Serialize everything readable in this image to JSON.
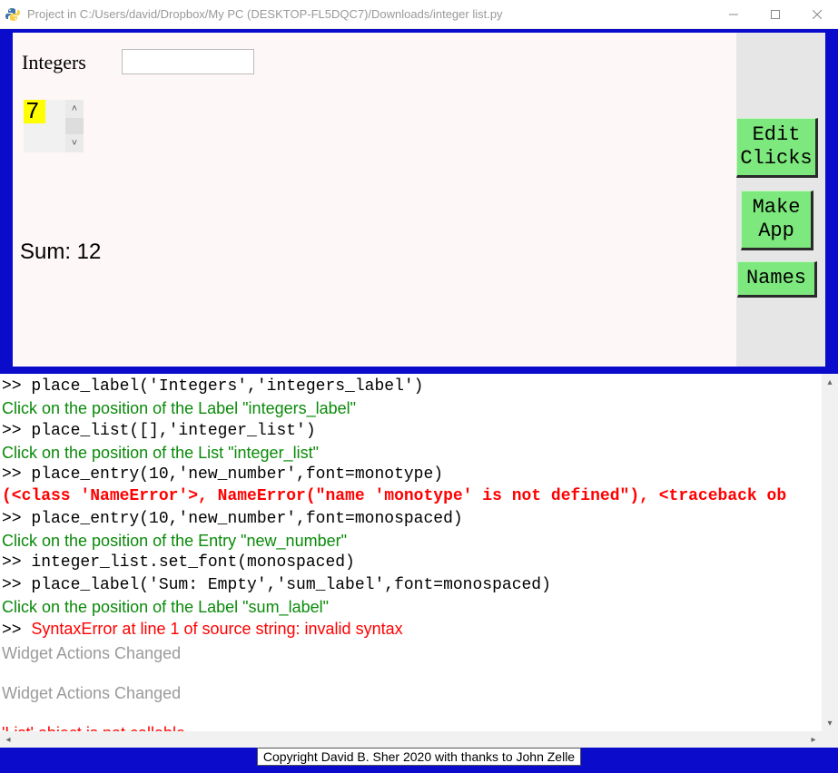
{
  "window": {
    "title": "Project in C:/Users/david/Dropbox/My PC (DESKTOP-FL5DQC7)/Downloads/integer list.py"
  },
  "panel": {
    "integers_label": "Integers",
    "entry_value": "",
    "list_selected": "7",
    "sum_label": "Sum: 12"
  },
  "buttons": {
    "edit_clicks": "Edit\nClicks",
    "make_app": "Make\nApp",
    "names": "Names"
  },
  "console_lines": [
    {
      "cls": "mono",
      "text": ">> place_label('Integers','integers_label')"
    },
    {
      "cls": "green",
      "text": "Click on the position of the Label \"integers_label\""
    },
    {
      "cls": "mono",
      "text": ">> place_list([],'integer_list')"
    },
    {
      "cls": "green",
      "text": "Click on the position of the List \"integer_list\""
    },
    {
      "cls": "mono",
      "text": ">> place_entry(10,'new_number',font=monotype)"
    },
    {
      "cls": "redmono",
      "text": "(<class 'NameError'>, NameError(\"name 'monotype' is not defined\"), <traceback ob"
    },
    {
      "cls": "mono",
      "text": ">> place_entry(10,'new_number',font=monospaced)"
    },
    {
      "cls": "green",
      "text": "Click on the position of the Entry \"new_number\""
    },
    {
      "cls": "mono",
      "text": ">> integer_list.set_font(monospaced)"
    },
    {
      "cls": "mono",
      "text": ">> place_label('Sum: Empty','sum_label',font=monospaced)"
    },
    {
      "cls": "green",
      "text": "Click on the position of the Label \"sum_label\""
    },
    {
      "cls": "red-prefix",
      "prefix": ">>  ",
      "text": "SyntaxError at line 1 of source string: invalid syntax"
    },
    {
      "cls": "gray",
      "text": "Widget Actions Changed"
    },
    {
      "cls": "blank",
      "text": ""
    },
    {
      "cls": "gray",
      "text": "Widget Actions Changed"
    },
    {
      "cls": "blank",
      "text": ""
    },
    {
      "cls": "red",
      "text": "'List' object is not callable"
    }
  ],
  "footer": {
    "copyright": "Copyright David B. Sher 2020 with thanks to John Zelle"
  }
}
